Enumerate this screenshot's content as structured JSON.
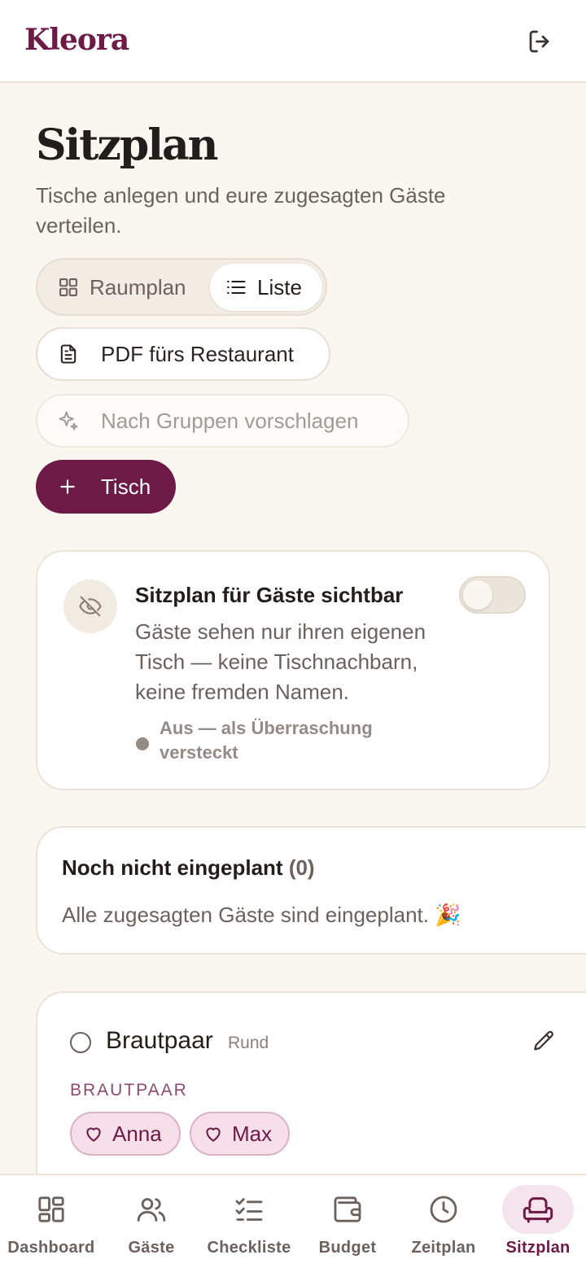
{
  "header": {
    "brand": "Kleora",
    "logout_icon": "logout-icon"
  },
  "page": {
    "title": "Sitzplan",
    "subtitle": "Tische anlegen und eure zugesagten Gäste verteilen."
  },
  "view_toggle": {
    "options": [
      {
        "label": "Raumplan",
        "icon": "grid-icon",
        "active": false
      },
      {
        "label": "Liste",
        "icon": "list-icon",
        "active": true
      }
    ]
  },
  "actions": {
    "pdf_label": "PDF fürs Restaurant",
    "suggest_label": "Nach Gruppen vorschlagen",
    "add_table_label": "Tisch"
  },
  "visibility": {
    "title": "Sitzplan für Gäste sichtbar",
    "description": "Gäste sehen nur ihren eigenen Tisch — keine Tischnachbarn, keine fremden Namen.",
    "status": "Aus — als Überraschung versteckt",
    "enabled": false
  },
  "unplanned": {
    "title": "Noch nicht eingeplant",
    "count": "(0)",
    "message": "Alle zugesagten Gäste sind eingeplant. 🎉"
  },
  "tables": [
    {
      "name": "Brautpaar",
      "shape": "Rund",
      "group_label": "BRAUTPAAR",
      "guests": [
        "Anna",
        "Max"
      ]
    }
  ],
  "bottom_nav": [
    {
      "label": "Dashboard",
      "icon": "dashboard-icon",
      "active": false
    },
    {
      "label": "Gäste",
      "icon": "users-icon",
      "active": false
    },
    {
      "label": "Checkliste",
      "icon": "checklist-icon",
      "active": false
    },
    {
      "label": "Budget",
      "icon": "wallet-icon",
      "active": false
    },
    {
      "label": "Zeitplan",
      "icon": "clock-icon",
      "active": false
    },
    {
      "label": "Sitzplan",
      "icon": "armchair-icon",
      "active": true
    }
  ],
  "colors": {
    "accent": "#6d1a47",
    "background": "#faf6f0",
    "chip_bg": "#f6dfe9"
  }
}
